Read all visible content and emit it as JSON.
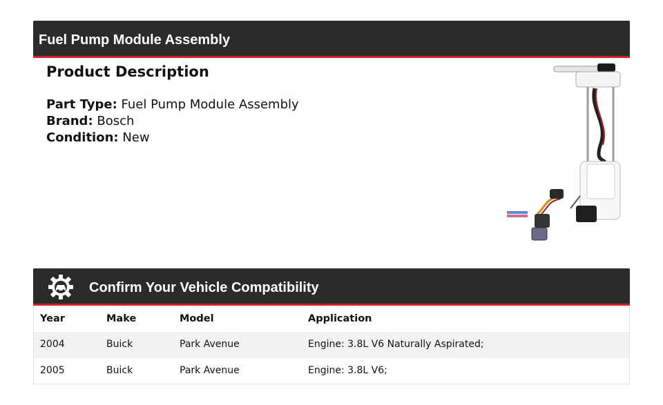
{
  "header": {
    "title": "Fuel Pump Module Assembly"
  },
  "description": {
    "heading": "Product Description",
    "part_type_label": "Part Type:",
    "part_type_value": "Fuel Pump Module Assembly",
    "brand_label": "Brand:",
    "brand_value": "Bosch",
    "condition_label": "Condition:",
    "condition_value": "New"
  },
  "compatibility": {
    "title": "Confirm Your Vehicle Compatibility",
    "icon": "gear-car-icon",
    "columns": [
      "Year",
      "Make",
      "Model",
      "Application"
    ],
    "rows": [
      [
        "2004",
        "Buick",
        "Park Avenue",
        "Engine: 3.8L V6 Naturally Aspirated;"
      ],
      [
        "2005",
        "Buick",
        "Park Avenue",
        "Engine: 3.8L V6;"
      ]
    ]
  },
  "colors": {
    "banner": "#2b2b2b",
    "accent": "#d0202a",
    "alt_row": "#f2f2f2"
  }
}
